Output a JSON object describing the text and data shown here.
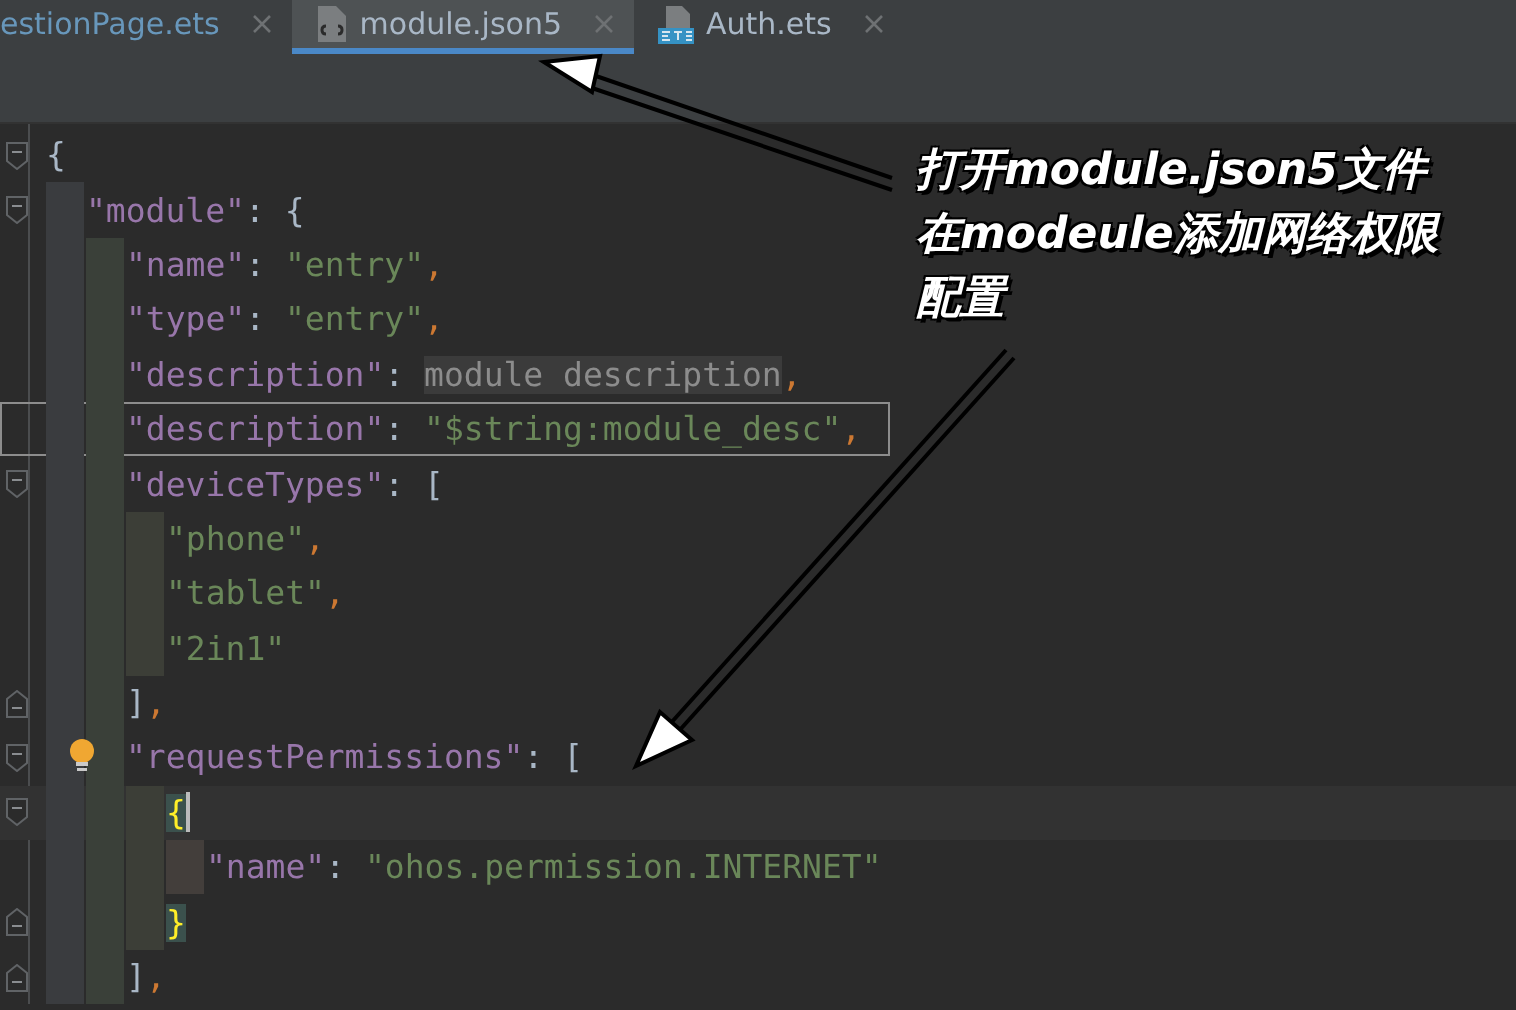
{
  "tabs": [
    {
      "label": "estionPage.ets",
      "kind": "plain",
      "selected": false
    },
    {
      "label": "module.json5",
      "kind": "json",
      "selected": true
    },
    {
      "label": "Auth.ets",
      "kind": "ets",
      "selected": false
    }
  ],
  "editor": {
    "lines": [
      {
        "kind": "open",
        "bulb": false,
        "boxed": false,
        "caret": false,
        "tokens": [
          {
            "kind": "punct",
            "s": "{"
          }
        ],
        "children": [
          {
            "kind": "open",
            "bulb": false,
            "boxed": false,
            "caret": false,
            "tokens": [
              {
                "kind": "key",
                "s": "\"module\""
              },
              {
                "kind": "punct",
                "s": ": "
              },
              {
                "kind": "punct",
                "s": "{"
              }
            ],
            "children": [
              {
                "bulb": false,
                "boxed": false,
                "caret": false,
                "tokens": [
                  {
                    "kind": "key",
                    "s": "\"name\""
                  },
                  {
                    "kind": "punct",
                    "s": ": "
                  },
                  {
                    "kind": "str",
                    "s": "\"entry\""
                  },
                  {
                    "kind": "comma",
                    "s": ","
                  }
                ]
              },
              {
                "bulb": false,
                "boxed": false,
                "caret": false,
                "tokens": [
                  {
                    "kind": "key",
                    "s": "\"type\""
                  },
                  {
                    "kind": "punct",
                    "s": ": "
                  },
                  {
                    "kind": "str",
                    "s": "\"entry\""
                  },
                  {
                    "kind": "comma",
                    "s": ","
                  }
                ]
              },
              {
                "bulb": false,
                "boxed": false,
                "caret": false,
                "tokens": [
                  {
                    "kind": "key",
                    "s": "\"description\""
                  },
                  {
                    "kind": "punct",
                    "s": ": "
                  },
                  {
                    "kind": "hint",
                    "s": "module description"
                  },
                  {
                    "kind": "comma",
                    "s": ","
                  }
                ]
              },
              {
                "bulb": false,
                "boxed": true,
                "caret": false,
                "tokens": [
                  {
                    "kind": "key",
                    "s": "\"description\""
                  },
                  {
                    "kind": "punct",
                    "s": ": "
                  },
                  {
                    "kind": "str",
                    "s": "\"$string:module_desc\""
                  },
                  {
                    "kind": "comma",
                    "s": ","
                  }
                ]
              },
              {
                "kind": "open",
                "bulb": false,
                "boxed": false,
                "caret": false,
                "tokens": [
                  {
                    "kind": "key",
                    "s": "\"deviceTypes\""
                  },
                  {
                    "kind": "punct",
                    "s": ": "
                  },
                  {
                    "kind": "punct",
                    "s": "["
                  }
                ],
                "children": [
                  {
                    "bulb": false,
                    "boxed": false,
                    "caret": false,
                    "tokens": [
                      {
                        "kind": "str",
                        "s": "\"phone\""
                      },
                      {
                        "kind": "comma",
                        "s": ","
                      }
                    ]
                  },
                  {
                    "bulb": false,
                    "boxed": false,
                    "caret": false,
                    "tokens": [
                      {
                        "kind": "str",
                        "s": "\"tablet\""
                      },
                      {
                        "kind": "comma",
                        "s": ","
                      }
                    ]
                  },
                  {
                    "bulb": false,
                    "boxed": false,
                    "caret": false,
                    "tokens": [
                      {
                        "kind": "str",
                        "s": "\"2in1\""
                      }
                    ]
                  }
                ]
              },
              {
                "kind": "close",
                "bulb": false,
                "boxed": false,
                "caret": false,
                "tokens": [
                  {
                    "kind": "punct",
                    "s": "]"
                  },
                  {
                    "kind": "comma",
                    "s": ","
                  }
                ]
              },
              {
                "kind": "open",
                "bulb": true,
                "boxed": false,
                "caret": false,
                "tokens": [
                  {
                    "kind": "key",
                    "s": "\"requestPermissions\""
                  },
                  {
                    "kind": "punct",
                    "s": ": "
                  },
                  {
                    "kind": "punct",
                    "s": "["
                  }
                ],
                "children": [
                  {
                    "kind": "open",
                    "bulb": false,
                    "boxed": false,
                    "caret": true,
                    "tokens": [
                      {
                        "kind": "match",
                        "s": "{"
                      }
                    ],
                    "children": [
                      {
                        "bulb": false,
                        "boxed": false,
                        "caret": false,
                        "tokens": [
                          {
                            "kind": "key",
                            "s": "\"name\""
                          },
                          {
                            "kind": "punct",
                            "s": ": "
                          },
                          {
                            "kind": "str",
                            "s": "\"ohos.permission.INTERNET\""
                          }
                        ]
                      }
                    ]
                  },
                  {
                    "kind": "close",
                    "bulb": false,
                    "boxed": false,
                    "caret": false,
                    "tokens": [
                      {
                        "kind": "match",
                        "s": "}"
                      }
                    ]
                  }
                ]
              },
              {
                "kind": "close",
                "bulb": false,
                "boxed": false,
                "caret": false,
                "tokens": [
                  {
                    "kind": "punct",
                    "s": "]"
                  },
                  {
                    "kind": "comma",
                    "s": ","
                  }
                ]
              }
            ]
          }
        ]
      }
    ]
  },
  "callout": {
    "lines": [
      "打开module.json5文件",
      "在modeule添加网络权限",
      "配置"
    ]
  }
}
